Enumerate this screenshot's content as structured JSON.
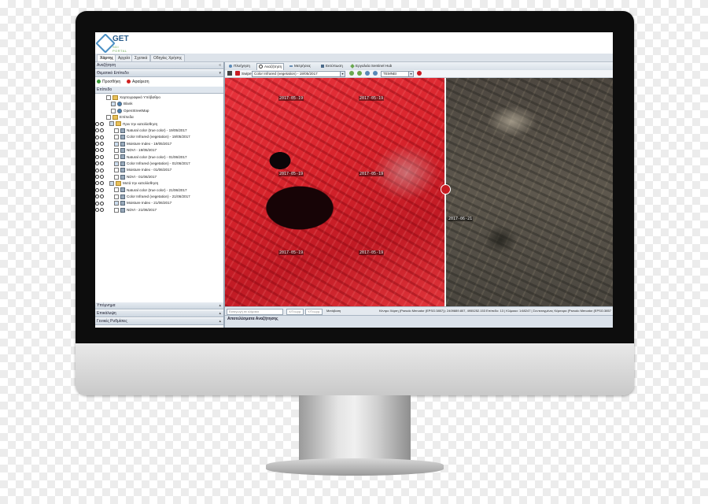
{
  "app": {
    "logo_text": "GET",
    "logo_sub": "SDI PORTAL"
  },
  "tabs": [
    "Χάρτης",
    "Αρχεία",
    "Σχετικά",
    "Οδηγίες Χρήσης"
  ],
  "left": {
    "search_bar": "Αναζήτηση",
    "thematic_bar": "Θεματικό Επίπεδο",
    "add_label": "Προσθήκη",
    "remove_label": "Αφαίρεση",
    "layers_header": "Επίπεδο",
    "tree": [
      {
        "label": "Χαρτογραφικό Υπόβαθρο",
        "kind": "folder",
        "indent": 0
      },
      {
        "label": "Blank",
        "kind": "radio",
        "indent": 1
      },
      {
        "label": "OpenStreetMap",
        "kind": "radio",
        "indent": 1
      },
      {
        "label": "Επίπεδα",
        "kind": "folder",
        "indent": 0
      },
      {
        "label": "Πριν την κατολίσθηση",
        "kind": "folder",
        "indent": 1
      },
      {
        "label": "Natural color (true color) - 19/05/2017",
        "kind": "layer",
        "indent": 2
      },
      {
        "label": "Color Infrared (vegetation) - 19/05/2017",
        "kind": "layer",
        "indent": 2
      },
      {
        "label": "Moisture Index - 19/05/2017",
        "kind": "layer",
        "indent": 2
      },
      {
        "label": "NDVI - 19/05/2017",
        "kind": "layer",
        "indent": 2
      },
      {
        "label": "Natural color (true color) - 01/06/2017",
        "kind": "layer",
        "indent": 2
      },
      {
        "label": "Color Infrared (vegetation) - 01/06/2017",
        "kind": "layer",
        "indent": 2
      },
      {
        "label": "Moisture Index - 01/06/2017",
        "kind": "layer",
        "indent": 2
      },
      {
        "label": "NDVI - 01/06/2017",
        "kind": "layer",
        "indent": 2
      },
      {
        "label": "Μετά την κατολίσθηση",
        "kind": "folder",
        "indent": 1
      },
      {
        "label": "Natural color (true color) - 21/06/2017",
        "kind": "layer",
        "indent": 2
      },
      {
        "label": "Color Infrared (vegetation) - 21/06/2017",
        "kind": "layer",
        "indent": 2
      },
      {
        "label": "Moisture Index - 21/06/2017",
        "kind": "layer",
        "indent": 2
      },
      {
        "label": "NDVI - 21/06/2017",
        "kind": "layer",
        "indent": 2
      }
    ],
    "bottom_bars": [
      "Υπόμνημα",
      "Επικάλυψη",
      "Γενικές Ρυθμίσεις"
    ]
  },
  "toolbar": {
    "buttons": [
      "Πλοήγηση",
      "Αναζήτηση",
      "Μετρήσεις",
      "Εκτύπωση",
      "Εργαλεία Sentinel Hub"
    ],
    "active": "Αναζήτηση"
  },
  "toolbar2": {
    "swipe_label": "Swipe",
    "layer_select": "Color Infrared (vegetation) - 19/05/2017",
    "district_select": "ΤΕΜΝΕΙ"
  },
  "map": {
    "left_date": "2017-05-19",
    "right_date": "2017-06-21"
  },
  "status": {
    "search_placeholder": "Εισαγωγή σε κλίμακα",
    "x_label": "Χ/Γεωγρ.",
    "y_label": "Υ/Γεωγρ.",
    "move_label": "Μετάβαση",
    "coords_text": "Κέντρο Χάρτη (Pseudo Mercator (EPSG:3857)): 2409889.807, 4955252.153 Επίπεδο: 13 | Κλίμακα: 1:68247 | Συντεταγμένες Κέρσορα (Pseudo Mercator (EPSG:3857)"
  },
  "results_label": "Αποτελέσματα Αναζήτησης",
  "colors": {
    "accent": "#c71b22",
    "panel": "#dde3ea",
    "ndvi_red": "#d8242c"
  }
}
